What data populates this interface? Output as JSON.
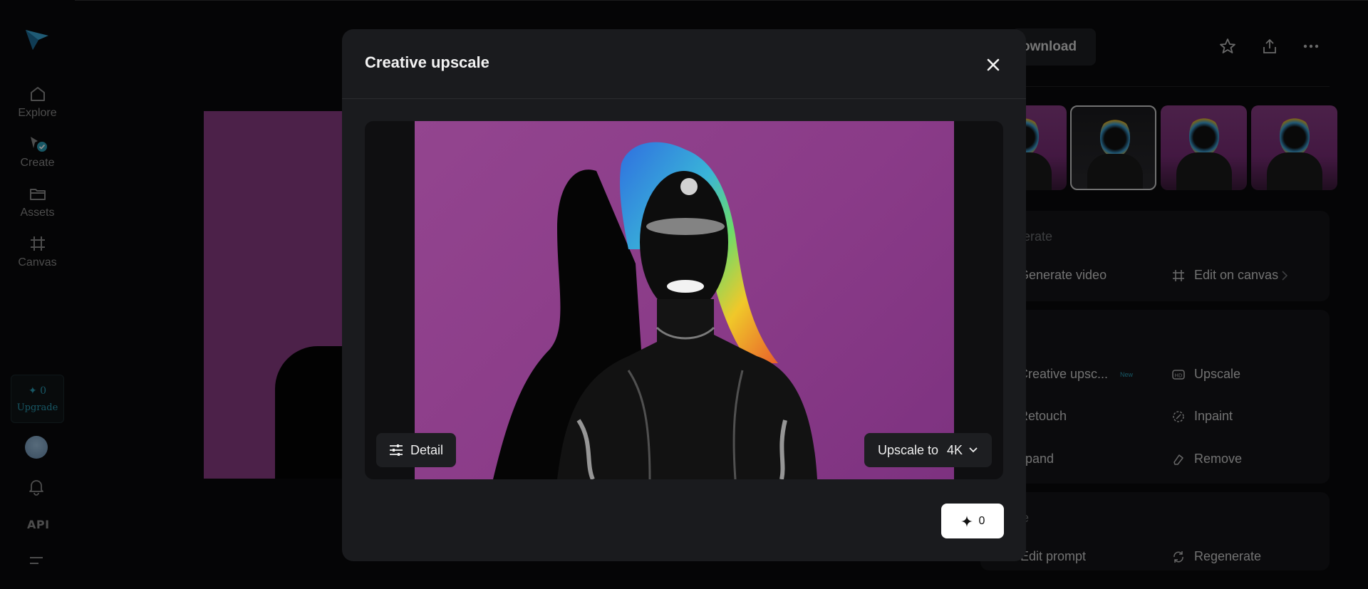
{
  "sidebar": {
    "items": [
      {
        "label": "Explore",
        "icon": "home-icon"
      },
      {
        "label": "Create",
        "icon": "create-icon"
      },
      {
        "label": "Assets",
        "icon": "folder-icon"
      },
      {
        "label": "Canvas",
        "icon": "canvas-icon"
      }
    ],
    "credits": "0",
    "upgrade_label": "Upgrade",
    "api_label": "API"
  },
  "right_panel": {
    "download_label": "ownload",
    "generate_section_label": "erate",
    "generate_video_label": "Generate video",
    "edit_on_canvas_label": "Edit on canvas",
    "creative_upscale_label": "Creative upsc...",
    "new_badge": "New",
    "upscale_label": "Upscale",
    "retouch_label": "Retouch",
    "inpaint_label": "Inpaint",
    "expand_label": "xpand",
    "remove_label": "Remove",
    "reuse_section_label": "e",
    "edit_prompt_label": "Edit prompt",
    "regenerate_label": "Regenerate"
  },
  "modal": {
    "title": "Creative upscale",
    "detail_label": "Detail",
    "upscale_prefix": "Upscale to",
    "upscale_value": "4K",
    "credit_cost": "0"
  },
  "colors": {
    "accent": "#2a9fb8",
    "photo_background": "#8a3b88",
    "modal_background": "#1a1b1e"
  }
}
